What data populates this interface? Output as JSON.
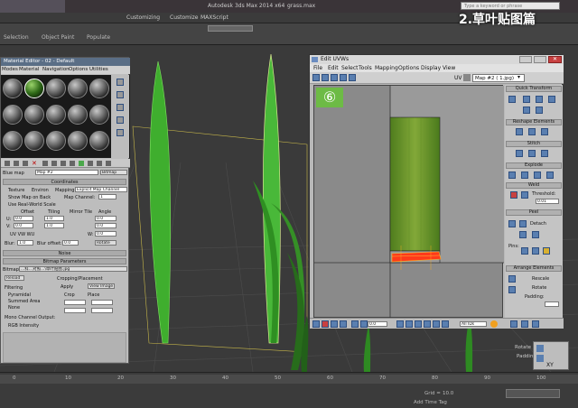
{
  "app": {
    "window_title": "Autodesk 3ds Max 2014 x64",
    "file_name": "grass.max",
    "search_placeholder": "Type a keyword or phrase",
    "top_menu": [
      "Customize",
      "MAXScript",
      "Customizing"
    ],
    "tab_labels": [
      "Selection",
      "Object Paint",
      "Populate"
    ],
    "banner": "2.草叶贴图篇"
  },
  "material_editor": {
    "title": "Material Editor - 02 - Default",
    "menu": [
      "Modes",
      "Material",
      "Navigation",
      "Options",
      "Utilities"
    ],
    "slot_count": 18,
    "selected_slot": 1,
    "map_label": "Blue map",
    "map_name": "Map #2",
    "map_type": "Bitmap",
    "coordinates_header": "Coordinates",
    "texture_label": "Texture",
    "environ_label": "Environ",
    "mapping_label": "Mapping:",
    "mapping_value": "Explicit Map Channel",
    "show_map_on_back": "Show Map on Back",
    "map_channel_label": "Map Channel:",
    "map_channel_value": "1",
    "use_real_world": "Use Real-World Scale",
    "offset_label": "Offset",
    "tiling_label": "Tiling",
    "mirror_tile_label": "Mirror Tile",
    "angle_label": "Angle",
    "u_label": "U:",
    "v_label": "V:",
    "w_label": "W:",
    "offset_u": "0.0",
    "offset_v": "0.0",
    "tiling_u": "1.0",
    "tiling_v": "1.0",
    "angle_u": "0.0",
    "angle_v": "0.0",
    "angle_w": "0.0",
    "uv_vw_wu": "UV   VW   WU",
    "blur_label": "Blur:",
    "blur_value": "1.0",
    "blur_offset_label": "Blur offset:",
    "blur_offset_value": "0.0",
    "rotate_label": "Rotate",
    "noise_header": "Noise",
    "bitmap_params_header": "Bitmap Parameters",
    "bitmap_label": "Bitmap:",
    "bitmap_path": "...科...对照...\\草叶贴图.jpg",
    "reload_label": "Reload",
    "cropping_label": "Cropping/Placement",
    "apply_label": "Apply",
    "view_image_label": "View Image",
    "filtering_label": "Filtering",
    "filter_options": [
      "Pyramidal",
      "Summed Area",
      "None"
    ],
    "crop_label": "Crop",
    "place_label": "Place",
    "mono_output_label": "Mono Channel Output:",
    "rgb_intensity": "RGB Intensity"
  },
  "uvw_editor": {
    "title": "Edit UVWs",
    "menu": [
      "File",
      "Edit",
      "Select",
      "Tools",
      "Mapping",
      "Options",
      "Display",
      "View"
    ],
    "uv_label": "UV",
    "map_dropdown": "Map #2 ( 1.jpg)",
    "step_badge": "⑥",
    "panels": [
      "Quick Transform",
      "Reshape Elements",
      "Stitch",
      "Explode",
      "Weld",
      "Peel",
      "Arrange Elements"
    ],
    "threshold_label": "Threshold:",
    "threshold_value": "0.01",
    "detach_label": "Detach",
    "pins_label": "Pins:",
    "rescale_label": "Rescale",
    "rotate_label": "Rotate",
    "padding_label": "Padding:",
    "all_ids": "All IDs",
    "field_value": "0.0",
    "xy_label": "XY"
  },
  "viewport": {
    "rotate_label": "Rotate",
    "padding_label": "Padding:"
  },
  "status": {
    "grid_label": "Grid =",
    "grid_value": "10.0",
    "add_time_tag": "Add Time Tag",
    "timeline_ticks": [
      "0",
      "10",
      "20",
      "30",
      "40",
      "50",
      "60",
      "70",
      "80",
      "90",
      "100"
    ]
  },
  "colors": {
    "grass": "#3fae2e",
    "uv_texture": "#6f9a2e",
    "selection": "#ff3a1a",
    "badge": "#6dbb45",
    "banner": "#ffffff"
  }
}
